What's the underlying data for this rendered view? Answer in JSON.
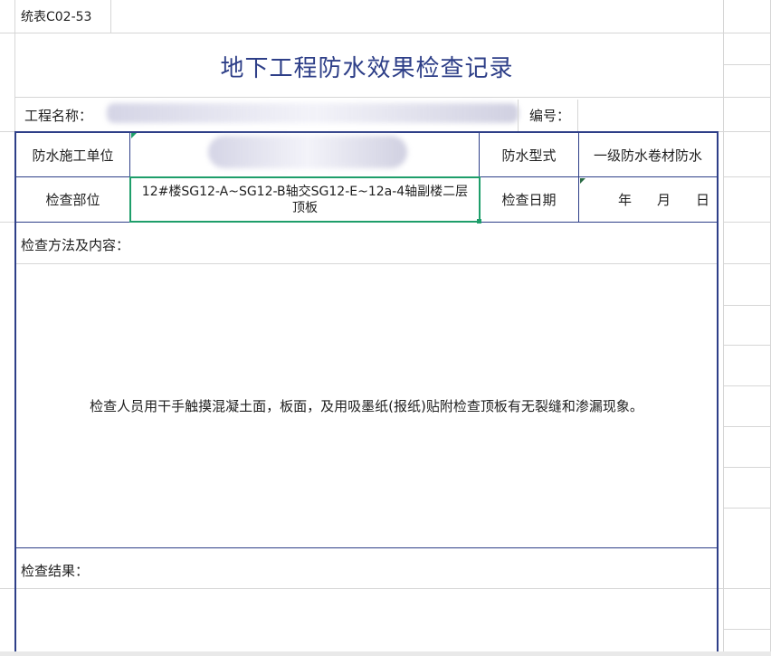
{
  "sheet": {
    "form_code": "统表C02-53",
    "title": "地下工程防水效果检查记录",
    "project_name_label": "工程名称：",
    "number_label": "编号：",
    "unit_label": "防水施工单位",
    "type_label": "防水型式",
    "type_value": "一级防水卷材防水",
    "location_label": "检查部位",
    "location_value": "12#楼SG12-A~SG12-B轴交SG12-E~12a-4轴副楼二层顶板",
    "date_label": "检查日期",
    "date_year": "年",
    "date_month": "月",
    "date_day": "日",
    "method_label": "检查方法及内容：",
    "method_text": "检查人员用干手触摸混凝土面，板面，及用吸墨纸(报纸)贴附检查顶板有无裂缝和渗漏现象。",
    "result_label": "检查结果："
  },
  "colors": {
    "border": "#2e3f88",
    "selection": "#1e9e6a",
    "gridline": "#d6d6d6"
  }
}
